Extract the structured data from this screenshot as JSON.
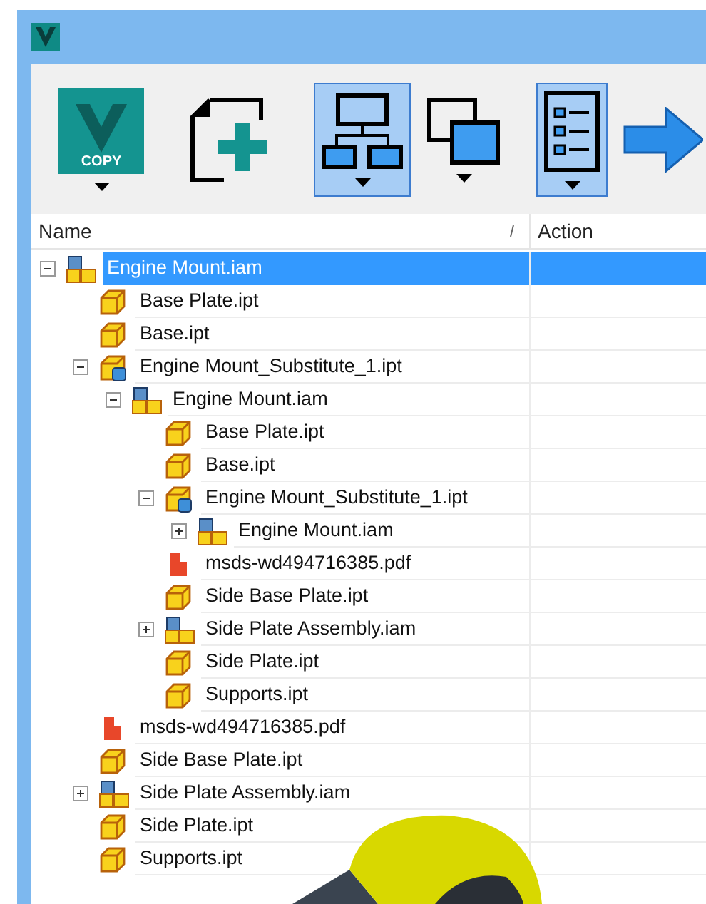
{
  "toolbar": [
    {
      "kind": "copy",
      "label": "COPY",
      "dropdown": true,
      "selected": false
    },
    {
      "kind": "new",
      "dropdown": false,
      "selected": false
    },
    {
      "kind": "structure",
      "dropdown": true,
      "selected": true
    },
    {
      "kind": "overlap",
      "dropdown": true,
      "selected": false
    },
    {
      "kind": "list",
      "dropdown": true,
      "selected": true
    },
    {
      "kind": "arrow",
      "dropdown": false,
      "selected": false
    }
  ],
  "table": {
    "columns": [
      "Name",
      "Action"
    ],
    "tree": [
      {
        "name": "Engine Mount.iam",
        "kind": "assembly",
        "selected": true,
        "expanded": true,
        "children": [
          {
            "name": "Base Plate.ipt",
            "kind": "part",
            "selected": false
          },
          {
            "name": "Base.ipt",
            "kind": "part",
            "selected": false
          },
          {
            "name": "Engine Mount_Substitute_1.ipt",
            "kind": "substitute",
            "selected": false,
            "expanded": true,
            "children": [
              {
                "name": "Engine Mount.iam",
                "kind": "assembly",
                "selected": false,
                "expanded": true,
                "children": [
                  {
                    "name": "Base Plate.ipt",
                    "kind": "part",
                    "selected": false
                  },
                  {
                    "name": "Base.ipt",
                    "kind": "part",
                    "selected": false
                  },
                  {
                    "name": "Engine Mount_Substitute_1.ipt",
                    "kind": "substitute",
                    "selected": false,
                    "expanded": true,
                    "children": [
                      {
                        "name": "Engine Mount.iam",
                        "kind": "assembly",
                        "selected": false,
                        "expanded": false
                      }
                    ]
                  },
                  {
                    "name": "msds-wd494716385.pdf",
                    "kind": "pdf",
                    "selected": false
                  },
                  {
                    "name": "Side Base Plate.ipt",
                    "kind": "part",
                    "selected": false
                  },
                  {
                    "name": "Side Plate Assembly.iam",
                    "kind": "assembly",
                    "selected": false,
                    "expanded": false
                  },
                  {
                    "name": "Side Plate.ipt",
                    "kind": "part",
                    "selected": false
                  },
                  {
                    "name": "Supports.ipt",
                    "kind": "part",
                    "selected": false
                  }
                ]
              }
            ]
          },
          {
            "name": "msds-wd494716385.pdf",
            "kind": "pdf",
            "selected": false
          },
          {
            "name": "Side Base Plate.ipt",
            "kind": "part",
            "selected": false
          },
          {
            "name": "Side Plate Assembly.iam",
            "kind": "assembly",
            "selected": false,
            "expanded": false
          },
          {
            "name": "Side Plate.ipt",
            "kind": "part",
            "selected": false
          },
          {
            "name": "Supports.ipt",
            "kind": "part",
            "selected": false
          }
        ]
      }
    ]
  }
}
